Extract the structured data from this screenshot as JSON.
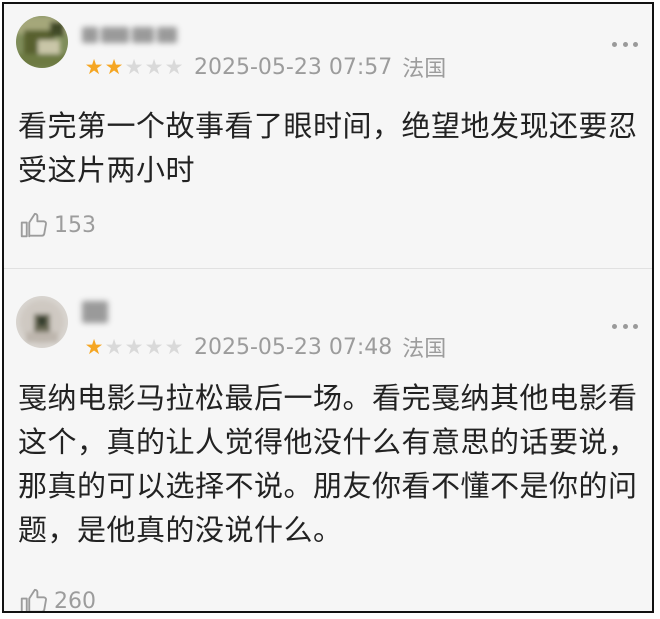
{
  "comments": [
    {
      "rating": 2,
      "max_rating": 5,
      "timestamp": "2025-05-23 07:57",
      "location": "法国",
      "text": "看完第一个故事看了眼时间，绝望地发现还要忍受这片两小时",
      "likes": "153"
    },
    {
      "rating": 1,
      "max_rating": 5,
      "timestamp": "2025-05-23 07:48",
      "location": "法国",
      "text": "戛纳电影马拉松最后一场。看完戛纳其他电影看这个，真的让人觉得他没什么有意思的话要说，那真的可以选择不说。朋友你看不懂不是你的问题，是他真的没说什么。",
      "likes": "260"
    }
  ],
  "colors": {
    "star_on": "#f5a623",
    "star_off": "#d9d9d9",
    "meta_text": "#9c9c9c",
    "background": "#f6f6f6"
  },
  "icons": {
    "more": "more-dots-icon",
    "like": "thumbs-up-icon",
    "star": "star-icon"
  }
}
